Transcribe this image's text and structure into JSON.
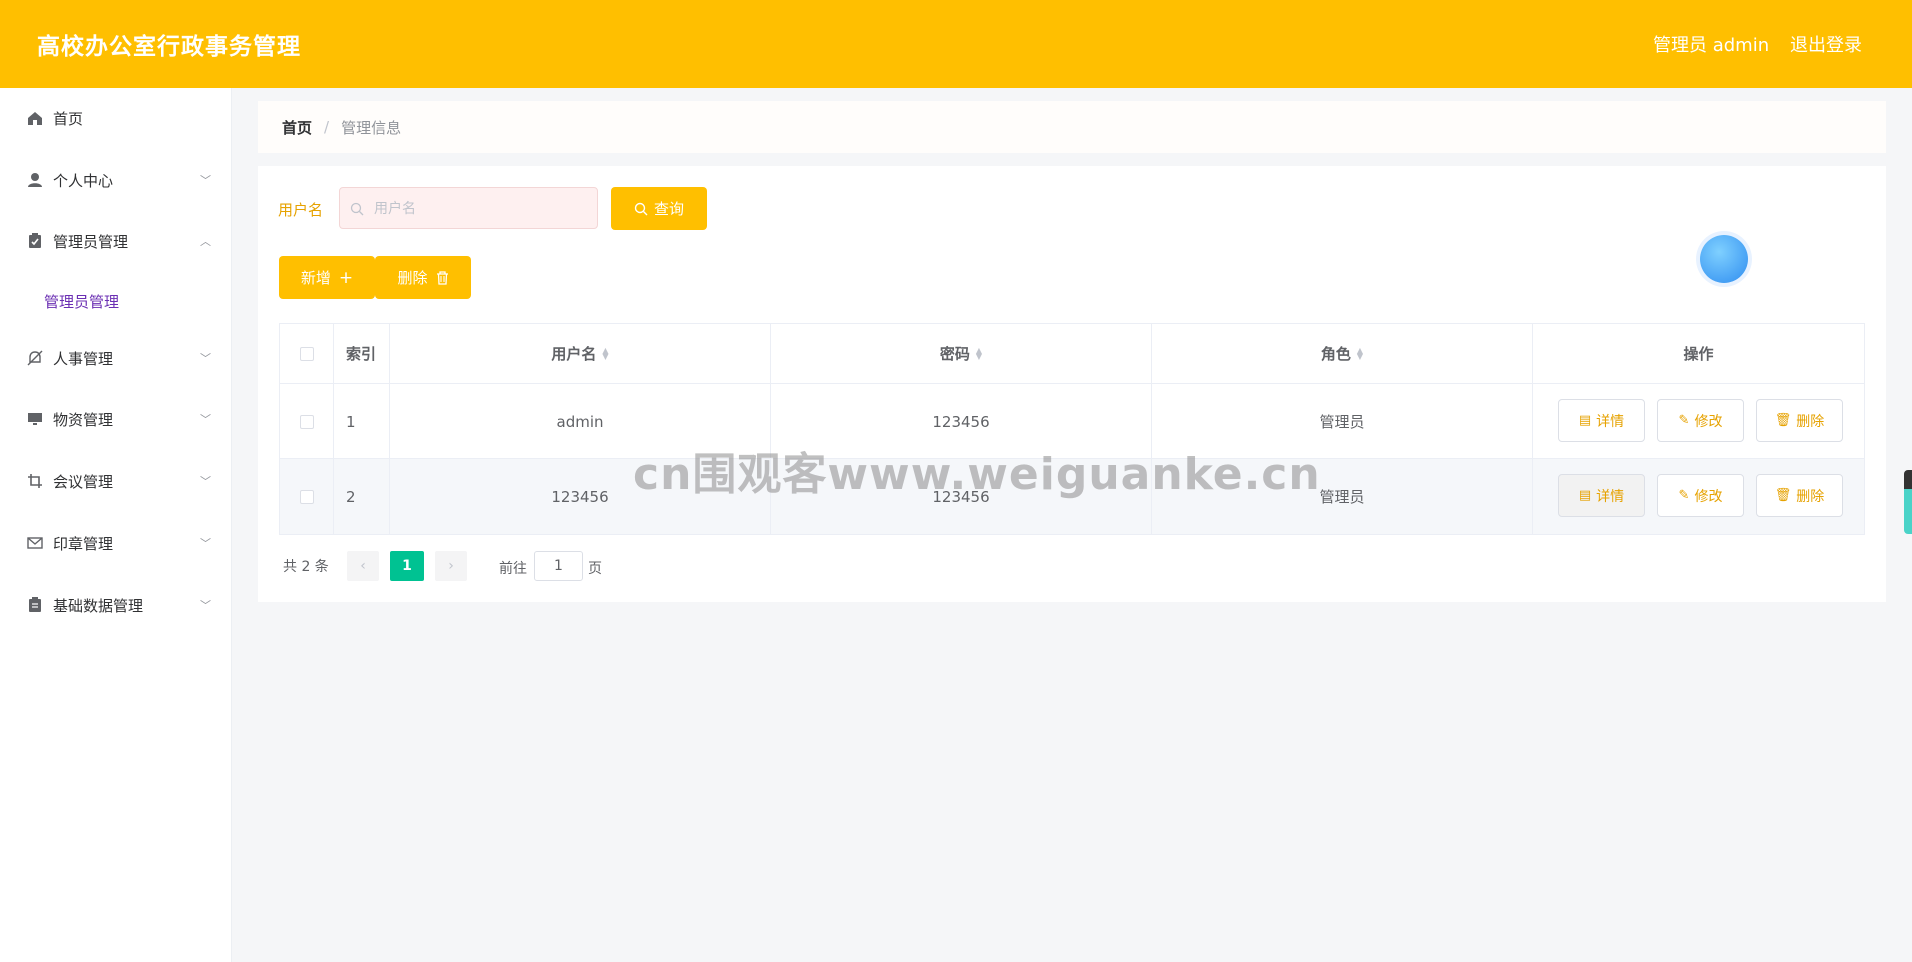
{
  "header": {
    "title": "高校办公室行政事务管理",
    "user": "管理员 admin",
    "logout": "退出登录"
  },
  "sidebar": {
    "items": [
      {
        "label": "首页",
        "icon": "home-icon",
        "expandable": false
      },
      {
        "label": "个人中心",
        "icon": "user-icon",
        "expandable": true
      },
      {
        "label": "管理员管理",
        "icon": "clipboard-check-icon",
        "expandable": true,
        "expanded": true,
        "children": [
          "管理员管理"
        ]
      },
      {
        "label": "人事管理",
        "icon": "bell-off-icon",
        "expandable": true
      },
      {
        "label": "物资管理",
        "icon": "monitor-icon",
        "expandable": true
      },
      {
        "label": "会议管理",
        "icon": "crop-icon",
        "expandable": true
      },
      {
        "label": "印章管理",
        "icon": "mail-icon",
        "expandable": true
      },
      {
        "label": "基础数据管理",
        "icon": "clipboard-list-icon",
        "expandable": true
      }
    ]
  },
  "breadcrumb": {
    "home": "首页",
    "separator": "/",
    "current": "管理信息"
  },
  "search": {
    "label": "用户名",
    "placeholder": "用户名",
    "value": "",
    "button": "查询"
  },
  "actions": {
    "add": "新增",
    "delete": "删除"
  },
  "table": {
    "columns": [
      "索引",
      "用户名",
      "密码",
      "角色",
      "操作"
    ],
    "rows": [
      {
        "index": "1",
        "username": "admin",
        "password": "123456",
        "role": "管理员"
      },
      {
        "index": "2",
        "username": "123456",
        "password": "123456",
        "role": "管理员"
      }
    ],
    "row_actions": {
      "detail": "详情",
      "edit": "修改",
      "delete": "删除"
    }
  },
  "pagination": {
    "total_text": "共 2 条",
    "current_page": "1",
    "goto_label": "前往",
    "goto_value": "1",
    "page_suffix": "页"
  },
  "watermark": "cn围观客www.weiguanke.cn",
  "colors": {
    "header": "#ffbf00",
    "accent_text": "#e6a200",
    "active_page": "#00c292",
    "submenu_active": "#6b2fb3"
  }
}
